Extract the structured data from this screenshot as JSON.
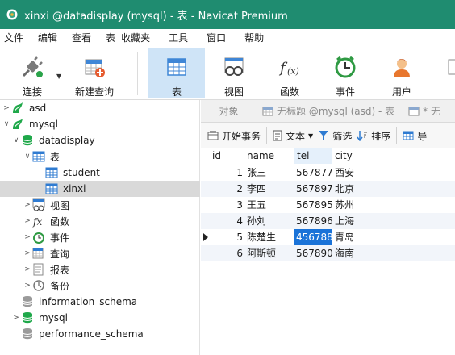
{
  "window": {
    "title": "xinxi @datadisplay (mysql) - 表 - Navicat Premium"
  },
  "menu": {
    "items": [
      "文件",
      "编辑",
      "查看",
      "表",
      "收藏夹",
      "工具",
      "窗口",
      "帮助"
    ]
  },
  "toolbar": {
    "connect_label": "连接",
    "new_query_label": "新建查询",
    "table_label": "表",
    "view_label": "视图",
    "function_label": "函数",
    "event_label": "事件",
    "user_label": "用户"
  },
  "nav": {
    "items": [
      {
        "label": "asd"
      },
      {
        "label": "mysql"
      },
      {
        "label": "datadisplay"
      },
      {
        "label": "表"
      },
      {
        "label": "student"
      },
      {
        "label": "xinxi"
      },
      {
        "label": "视图"
      },
      {
        "label": "函数"
      },
      {
        "label": "事件"
      },
      {
        "label": "查询"
      },
      {
        "label": "报表"
      },
      {
        "label": "备份"
      },
      {
        "label": "information_schema"
      },
      {
        "label": "mysql"
      },
      {
        "label": "performance_schema"
      }
    ]
  },
  "tabs": {
    "objects": "对象",
    "query": "无标题 @mysql (asd) - 表",
    "more": "* 无"
  },
  "table_toolbar": {
    "begin_transaction": "开始事务",
    "text": "文本",
    "filter": "筛选",
    "sort": "排序",
    "import": "导"
  },
  "grid": {
    "columns": [
      "id",
      "name",
      "tel",
      "city"
    ],
    "rows": [
      [
        "1",
        "张三",
        "567877",
        "西安"
      ],
      [
        "2",
        "李四",
        "567897",
        "北京"
      ],
      [
        "3",
        "王五",
        "567895",
        "苏州"
      ],
      [
        "4",
        "孙刘",
        "567896",
        "上海"
      ],
      [
        "5",
        "陈楚生",
        "456788",
        "青岛"
      ],
      [
        "6",
        "阿斯顿",
        "567890",
        "海南"
      ]
    ]
  },
  "colors": {
    "titlebar": "#1f8c70",
    "selection": "#1a73d8",
    "mysql_green": "#1fa84a",
    "table_blue": "#2f7bd1"
  }
}
